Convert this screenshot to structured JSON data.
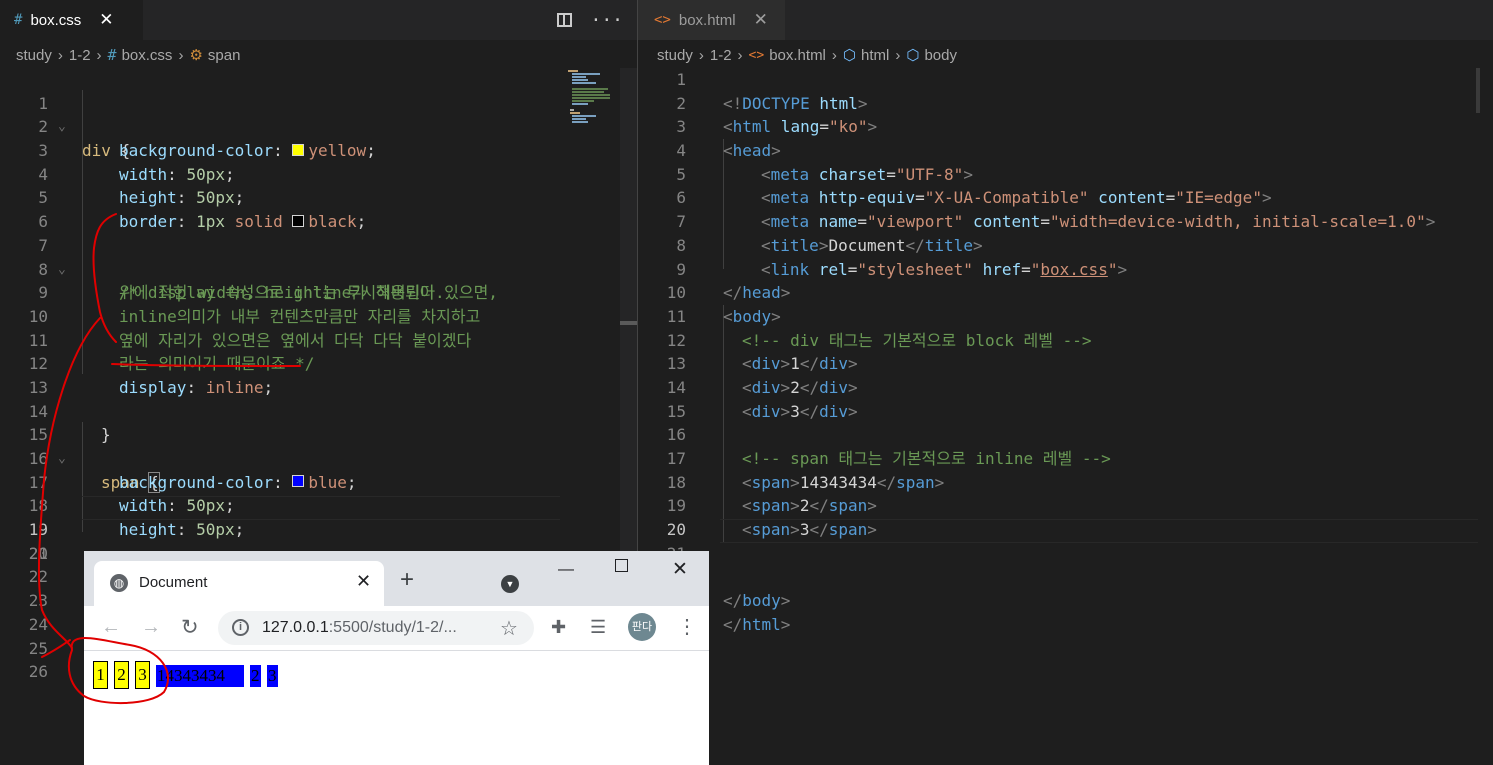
{
  "left_editor": {
    "tab": {
      "icon": "#",
      "label": "box.css"
    },
    "breadcrumb": [
      "study",
      "1-2",
      "box.css",
      "span"
    ],
    "lines": [
      "div {",
      "    background-color: yellow;",
      "    width: 50px;",
      "    height: 50px;",
      "    border: 1px solid black;",
      "",
      "    /* display 속성으로 inline가 적용되어 있으면,",
      "    위에 적힌 width, height는 무시해버린다.",
      "    inline의미가 내부 컨텐츠만큼만 자리를 차지하고",
      "    옆에 자리가 있으면은 옆에서 다닥 다닥 붙이겠다",
      "    라는 의미이기 때문이죠 */",
      "    display: inline;",
      "",
      "  }",
      "  span {",
      "    background-color: blue;",
      "    width: 50px;",
      "    height: 50px;",
      "",
      "  }",
      "",
      "",
      "",
      "",
      "",
      ""
    ],
    "line_numbers": [
      "1",
      "2",
      "3",
      "4",
      "5",
      "6",
      "7",
      "8",
      "9",
      "10",
      "11",
      "12",
      "13",
      "14",
      "15",
      "16",
      "17",
      "18",
      "19",
      "20",
      "21",
      "22",
      "23",
      "24",
      "25",
      "26"
    ],
    "current_line": "19"
  },
  "right_editor": {
    "tab": {
      "icon": "<>",
      "label": "box.html"
    },
    "breadcrumb": [
      "study",
      "1-2",
      "box.html",
      "html",
      "body"
    ],
    "lines": [
      "<!DOCTYPE html>",
      "<html lang=\"ko\">",
      "<head>",
      "    <meta charset=\"UTF-8\">",
      "    <meta http-equiv=\"X-UA-Compatible\" content=\"IE=edge\">",
      "    <meta name=\"viewport\" content=\"width=device-width, initial-scale=1.0\">",
      "    <title>Document</title>",
      "    <link rel=\"stylesheet\" href=\"box.css\">",
      "</head>",
      "<body>",
      "  <!-- div 태그는 기본적으로 block 레벨 -->",
      "  <div>1</div>",
      "  <div>2</div>",
      "  <div>3</div>",
      "",
      "  <!-- span 태그는 기본적으로 inline 레벨 -->",
      "  <span>14343434</span>",
      "  <span>2</span>",
      "  <span>3</span>",
      "",
      "",
      "</body>",
      "</html>"
    ],
    "line_numbers": [
      "1",
      "2",
      "3",
      "4",
      "5",
      "6",
      "7",
      "8",
      "9",
      "10",
      "11",
      "12",
      "13",
      "14",
      "15",
      "16",
      "17",
      "18",
      "19",
      "20",
      "21"
    ],
    "current_line": "20"
  },
  "browser": {
    "tab_title": "Document",
    "url_host": "127.0.0.1",
    "url_rest": ":5500/study/1-2/...",
    "avatar_label": "판다",
    "divs": [
      "1",
      "2",
      "3"
    ],
    "spans": [
      "14343434",
      "2",
      "3"
    ]
  },
  "colors": {
    "annotation": "#e00000",
    "yellow": "#ffff00",
    "blue": "#0000ff"
  }
}
